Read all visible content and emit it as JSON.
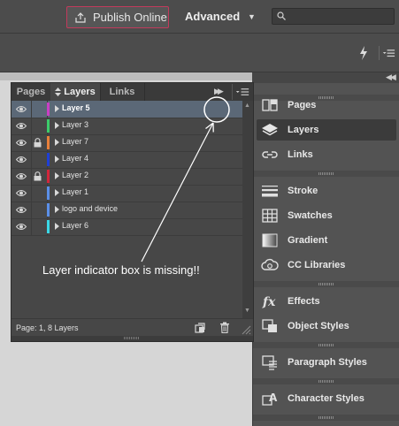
{
  "toolbar": {
    "publish_online_label": "Publish Online",
    "workspace_label": "Advanced",
    "search_value": ""
  },
  "layers_panel": {
    "tabs": [
      {
        "label": "Pages",
        "active": false
      },
      {
        "label": "Layers",
        "active": true
      },
      {
        "label": "Links",
        "active": false
      }
    ],
    "layers": [
      {
        "name": "Layer 5",
        "color": "#c93fc4",
        "locked": false,
        "visible": true,
        "selected": true
      },
      {
        "name": "Layer 3",
        "color": "#3ccc6a",
        "locked": false,
        "visible": true,
        "selected": false
      },
      {
        "name": "Layer 7",
        "color": "#e8803a",
        "locked": true,
        "visible": true,
        "selected": false
      },
      {
        "name": "Layer 4",
        "color": "#1f3fd6",
        "locked": false,
        "visible": true,
        "selected": false
      },
      {
        "name": "Layer 2",
        "color": "#d2263b",
        "locked": true,
        "visible": true,
        "selected": false
      },
      {
        "name": "Layer 1",
        "color": "#5b8fe8",
        "locked": false,
        "visible": true,
        "selected": false
      },
      {
        "name": "logo and device",
        "color": "#5b8fe8",
        "locked": false,
        "visible": true,
        "selected": false
      },
      {
        "name": "Layer 6",
        "color": "#3ad8e6",
        "locked": false,
        "visible": true,
        "selected": false
      }
    ],
    "status": "Page: 1, 8 Layers"
  },
  "dock": {
    "groups": [
      [
        {
          "label": "Pages",
          "icon": "pages-icon",
          "active": false
        },
        {
          "label": "Layers",
          "icon": "layers-icon",
          "active": true
        },
        {
          "label": "Links",
          "icon": "links-icon",
          "active": false
        }
      ],
      [
        {
          "label": "Stroke",
          "icon": "stroke-icon",
          "active": false
        },
        {
          "label": "Swatches",
          "icon": "swatches-icon",
          "active": false
        },
        {
          "label": "Gradient",
          "icon": "gradient-icon",
          "active": false
        },
        {
          "label": "CC Libraries",
          "icon": "cc-libraries-icon",
          "active": false
        }
      ],
      [
        {
          "label": "Effects",
          "icon": "effects-icon",
          "active": false
        },
        {
          "label": "Object Styles",
          "icon": "object-styles-icon",
          "active": false
        }
      ],
      [
        {
          "label": "Paragraph Styles",
          "icon": "paragraph-styles-icon",
          "active": false
        }
      ],
      [
        {
          "label": "Character Styles",
          "icon": "character-styles-icon",
          "active": false
        }
      ]
    ]
  },
  "annotation": {
    "text": "Layer indicator box is missing!!"
  },
  "colors": {
    "publish_border": "#c23a5c",
    "selection": "#5b6877",
    "panel_bg": "#474747"
  }
}
